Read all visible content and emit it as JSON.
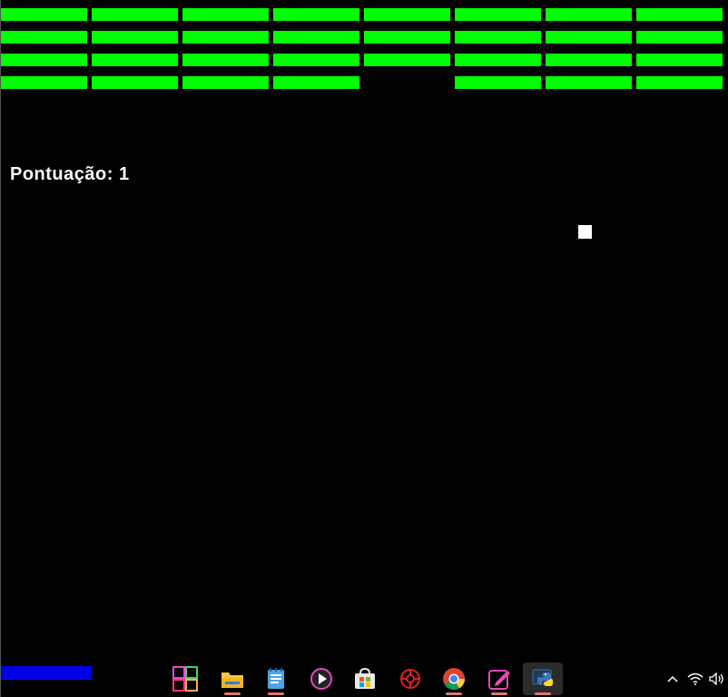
{
  "score": {
    "label": "Pontuação: 1"
  },
  "colors": {
    "brick": "#00ff00",
    "paddle": "#0000e6",
    "ball": "#ffffff",
    "background": "#000000"
  },
  "bricks": {
    "rows": [
      [
        true,
        true,
        true,
        true,
        true,
        true,
        true,
        true
      ],
      [
        true,
        true,
        true,
        true,
        true,
        true,
        true,
        true
      ],
      [
        true,
        true,
        true,
        true,
        true,
        true,
        true,
        true
      ],
      [
        true,
        true,
        true,
        true,
        false,
        true,
        true,
        true
      ]
    ]
  },
  "taskbar": {
    "icons": [
      "widgets-icon",
      "file-explorer-icon",
      "notepad-icon",
      "media-player-icon",
      "store-icon",
      "security-icon",
      "chrome-icon",
      "editor-icon",
      "python-icon"
    ],
    "tray": [
      "chevron-up-icon",
      "wifi-icon",
      "volume-icon"
    ]
  }
}
